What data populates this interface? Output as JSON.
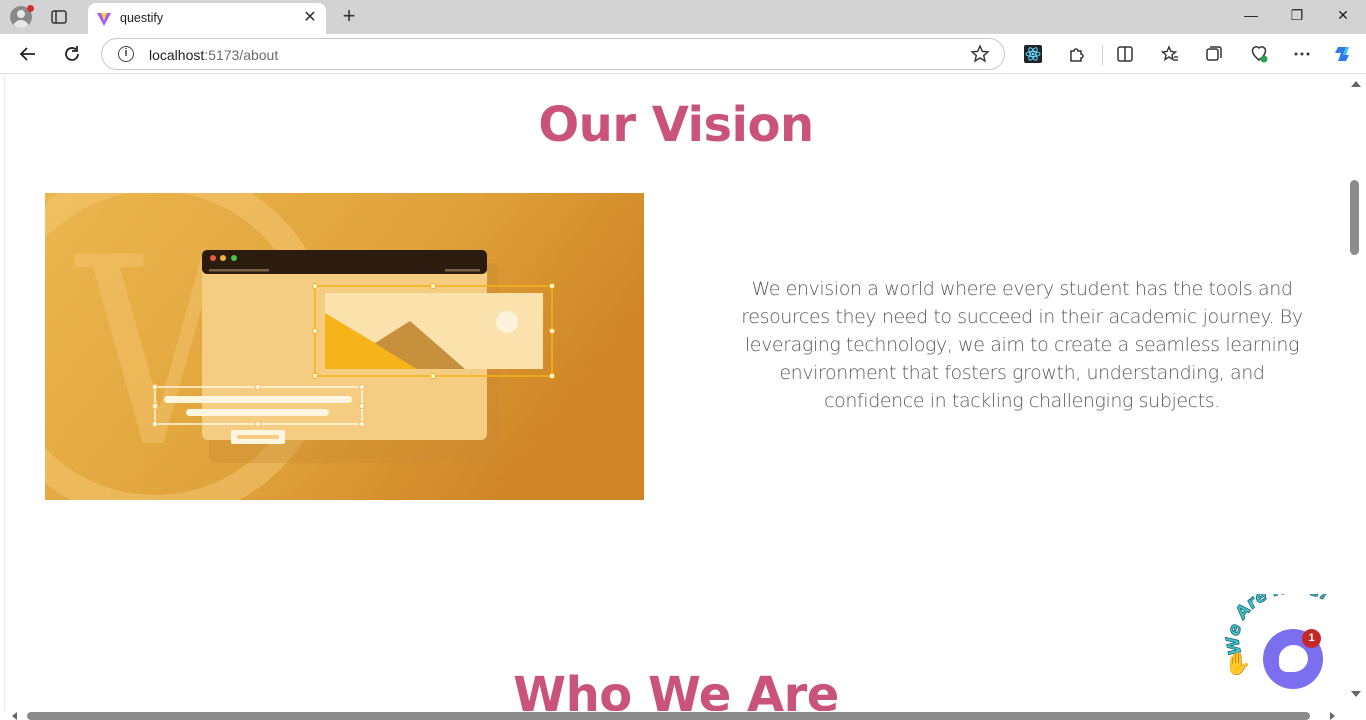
{
  "browser": {
    "tab_title": "questify",
    "url_host": "localhost",
    "url_rest": ":5173/about",
    "tab_close_glyph": "✕",
    "new_tab_glyph": "+"
  },
  "page": {
    "vision_heading": "Our Vision",
    "vision_text": "We envision a world where every student has the tools and resources they need to succeed in their academic journey. By leveraging technology, we aim to create a seamless learning environment that fosters growth, understanding, and confidence in tackling challenging subjects.",
    "who_heading": "Who We Are"
  },
  "chat_widget": {
    "arc_text": "We Are Here!",
    "badge_count": "1",
    "hand_icon": "waving-hand-icon"
  },
  "colors": {
    "heading": "#c9537a",
    "chat_accent": "#7b6ff0",
    "illustration_bg": "#e0a53c"
  }
}
